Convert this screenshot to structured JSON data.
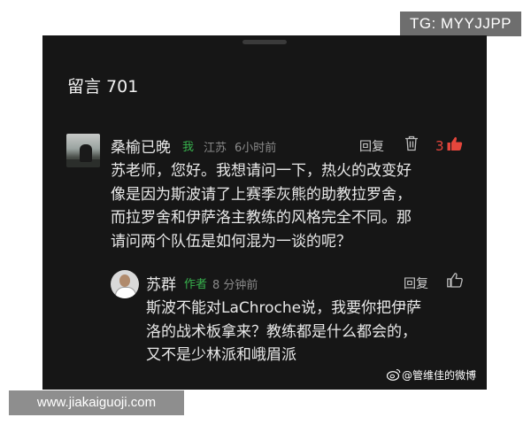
{
  "overlay": {
    "tg_label": "TG: MYYJJPP",
    "site_label": "www.jiakaiguoji.com"
  },
  "header": {
    "title": "留言",
    "count": "701"
  },
  "comments": [
    {
      "author": "桑榆已晚",
      "tag": "我",
      "location": "江苏",
      "time": "6小时前",
      "reply_label": "回复",
      "likes": "3",
      "lines": [
        "苏老师，您好。我想请问一下，热火的改变好",
        "像是因为斯波请了上赛季灰熊的助教拉罗舍，",
        "而拉罗舍和伊萨洛主教练的风格完全不同。那",
        "请问两个队伍是如何混为一谈的呢？"
      ]
    },
    {
      "author": "苏群",
      "tag": "作者",
      "time": "8 分钟前",
      "reply_label": "回复",
      "lines": [
        "斯波不能对LaChroche说，我要你把伊萨",
        "洛的战术板拿来？教练都是什么都会的，",
        "又不是少林派和峨眉派"
      ]
    }
  ],
  "watermark": "@管维佳的微博",
  "colors": {
    "panel_bg": "#161616",
    "accent_green": "#37b24d",
    "like_red": "#e6463c"
  },
  "icons": [
    "trash-icon",
    "thumbs-up-icon",
    "weibo-logo-icon"
  ]
}
